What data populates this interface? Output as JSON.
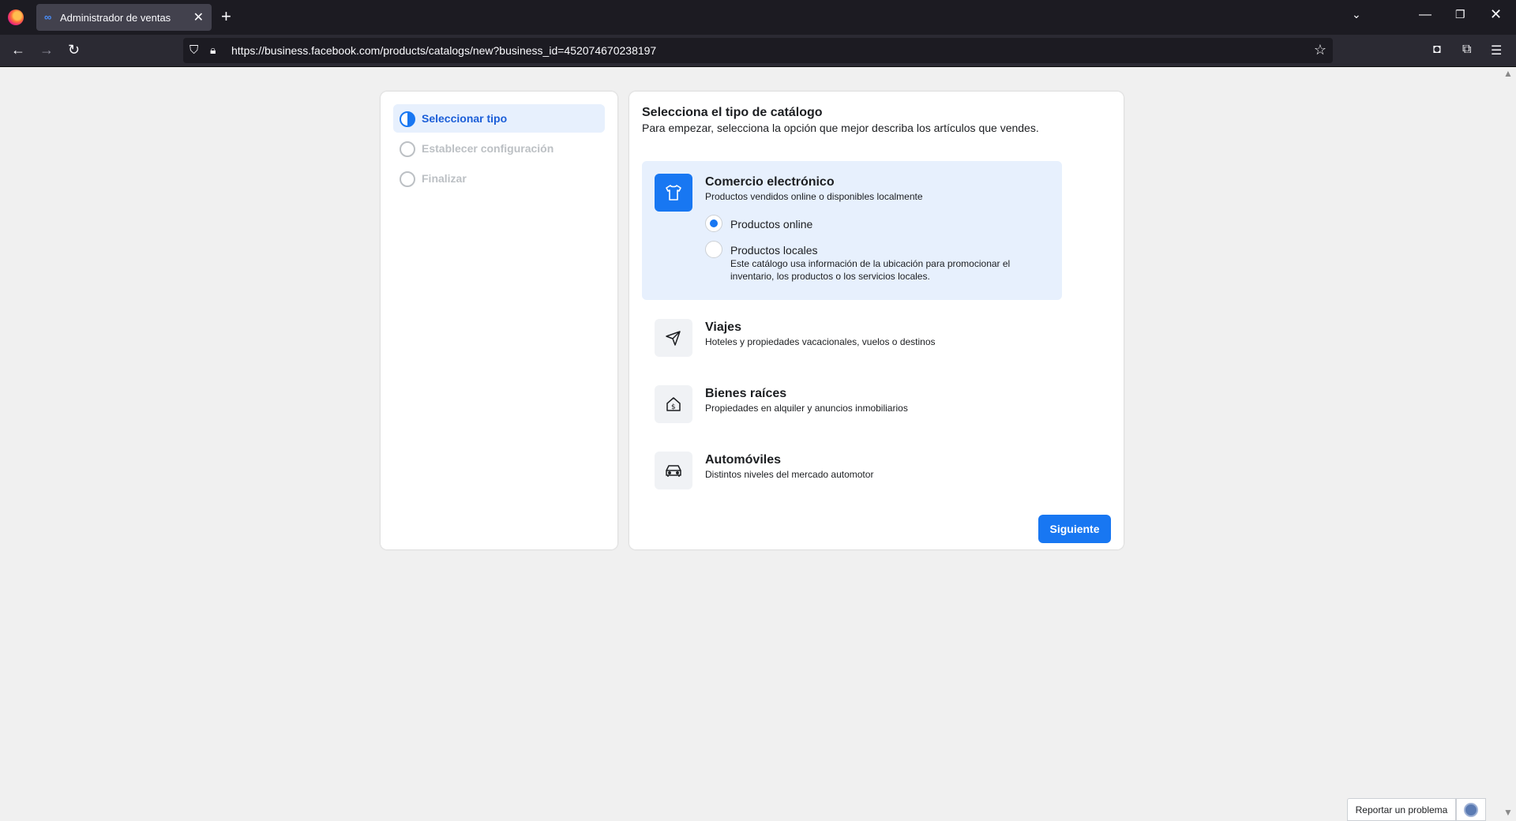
{
  "browser": {
    "tab_title": "Administrador de ventas",
    "tab_icon": "meta-logo-icon",
    "meta_glyph": "∞",
    "new_tab": "+",
    "url": "https://business.facebook.com/products/catalogs/new?business_id=452074670238197"
  },
  "steps": [
    {
      "label": "Seleccionar tipo",
      "state": "active"
    },
    {
      "label": "Establecer configuración",
      "state": "inactive"
    },
    {
      "label": "Finalizar",
      "state": "inactive"
    }
  ],
  "main": {
    "title": "Selecciona el tipo de catálogo",
    "subtitle": "Para empezar, selecciona la opción que mejor describa los artículos que vendes.",
    "options": [
      {
        "title": "Comercio electrónico",
        "desc": "Productos vendidos online o disponibles localmente",
        "icon": "tshirt-icon",
        "selected": true,
        "radios": [
          {
            "label": "Productos online",
            "checked": true,
            "desc": ""
          },
          {
            "label": "Productos locales",
            "checked": false,
            "desc": "Este catálogo usa información de la ubicación para promocionar el inventario, los productos o los servicios locales."
          }
        ]
      },
      {
        "title": "Viajes",
        "desc": "Hoteles y propiedades vacacionales, vuelos o destinos",
        "icon": "airplane-icon",
        "selected": false
      },
      {
        "title": "Bienes raíces",
        "desc": "Propiedades en alquiler y anuncios inmobiliarios",
        "icon": "house-dollar-icon",
        "selected": false
      },
      {
        "title": "Automóviles",
        "desc": "Distintos niveles del mercado automotor",
        "icon": "car-icon",
        "selected": false
      }
    ],
    "next_label": "Siguiente"
  },
  "footer": {
    "report_label": "Reportar un problema"
  },
  "colors": {
    "accent": "#1877f2",
    "selected_bg": "#e7f0fd"
  }
}
